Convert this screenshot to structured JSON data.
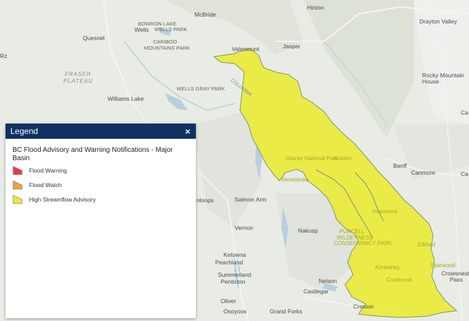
{
  "map": {
    "places": [
      "Hinton",
      "McBride",
      "BOWRON LAKE",
      "WELLS PARK",
      "Wells",
      "Drayton Valley",
      "Quesnel",
      "CARIBOO",
      "MOUNTAINS PARK",
      "Valemount",
      "Jasper",
      "FRASER",
      "PLATEAU",
      "Rocky Mountain",
      "House",
      "Williams Lake",
      "WELLS GRAY PARK",
      "Glacier National Park",
      "Golden",
      "Banff",
      "Canmore",
      "Revelstoke",
      "Salmon Arm",
      "nloops",
      "Vernon",
      "Nakusp",
      "PURCELL",
      "WILDERNESS",
      "CONSERVANCY PARK",
      "Invermere",
      "Kelowna",
      "Peachland",
      "Summerland",
      "Penticton",
      "Elkford",
      "Sparwood",
      "Kimberley",
      "Cranbrook",
      "Crowsnest",
      "Pass",
      "Nelson",
      "Castlegar",
      "Oliver",
      "Osoyoos",
      "Grand Forks",
      "Creston",
      "COLUMBIA",
      "Ca",
      "Ca",
      "Rz"
    ],
    "basin_colors": {
      "high_streamflow_advisory": "#e9ea3a",
      "border": "#7f9174"
    }
  },
  "legend": {
    "title": "Legend",
    "close_icon": "×",
    "layer_title": "BC Flood Advisory and Warning Notifications - Major Basin",
    "items": [
      {
        "label": "Flood Warning",
        "color": "#e63946"
      },
      {
        "label": "Flood Watch",
        "color": "#f0a13c"
      },
      {
        "label": "High Streamflow Advisory",
        "color": "#e9ea3a"
      }
    ]
  }
}
